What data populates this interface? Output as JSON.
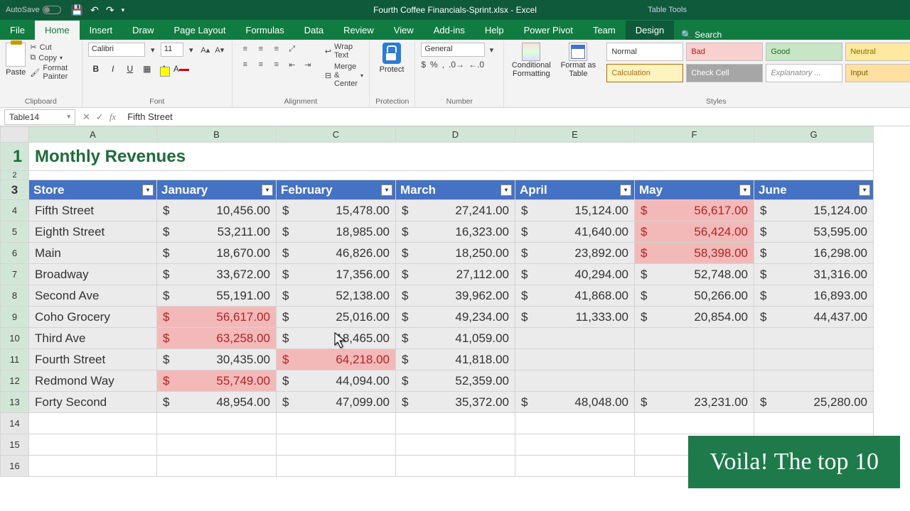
{
  "title_bar": {
    "autosave": "AutoSave",
    "doc_title": "Fourth Coffee Financials-Sprint.xlsx - Excel",
    "table_tools": "Table Tools"
  },
  "tabs": {
    "file": "File",
    "home": "Home",
    "insert": "Insert",
    "draw": "Draw",
    "page_layout": "Page Layout",
    "formulas": "Formulas",
    "data": "Data",
    "review": "Review",
    "view": "View",
    "help": "Help",
    "addins": "Add-ins",
    "power_pivot": "Power Pivot",
    "team": "Team",
    "design": "Design",
    "search": "Search"
  },
  "ribbon": {
    "clipboard": {
      "paste": "Paste",
      "cut": "Cut",
      "copy": "Copy",
      "format_painter": "Format Painter",
      "label": "Clipboard"
    },
    "font": {
      "name": "Calibri",
      "size": "11",
      "label": "Font"
    },
    "alignment": {
      "wrap": "Wrap Text",
      "merge": "Merge & Center",
      "label": "Alignment"
    },
    "protection": {
      "protect": "Protect",
      "label": "Protection"
    },
    "number": {
      "format": "General",
      "label": "Number"
    },
    "cf": "Conditional Formatting",
    "fat": "Format as Table",
    "styles": {
      "normal": "Normal",
      "bad": "Bad",
      "good": "Good",
      "neutral": "Neutral",
      "calculation": "Calculation",
      "check": "Check Cell",
      "explanatory": "Explanatory ...",
      "input": "Input",
      "label": "Styles"
    }
  },
  "fx": {
    "name_box": "Table14",
    "formula": "Fifth Street"
  },
  "sheet": {
    "title": "Monthly Revenues",
    "columns": [
      "A",
      "B",
      "C",
      "D",
      "E",
      "F",
      "G"
    ],
    "row_numbers": [
      1,
      2,
      3,
      4,
      5,
      6,
      7,
      8,
      9,
      10,
      11,
      12,
      13,
      14,
      15,
      16
    ],
    "headers": [
      "Store",
      "January",
      "February",
      "March",
      "April",
      "May",
      "June"
    ],
    "rows": [
      {
        "store": "Fifth Street",
        "vals": [
          "10,456.00",
          "15,478.00",
          "27,241.00",
          "15,124.00",
          "56,617.00",
          "15,124.00"
        ],
        "hl": [
          false,
          false,
          false,
          false,
          true,
          false
        ]
      },
      {
        "store": "Eighth Street",
        "vals": [
          "53,211.00",
          "18,985.00",
          "16,323.00",
          "41,640.00",
          "56,424.00",
          "53,595.00"
        ],
        "hl": [
          false,
          false,
          false,
          false,
          true,
          false
        ]
      },
      {
        "store": "Main",
        "vals": [
          "18,670.00",
          "46,826.00",
          "18,250.00",
          "23,892.00",
          "58,398.00",
          "16,298.00"
        ],
        "hl": [
          false,
          false,
          false,
          false,
          true,
          false
        ]
      },
      {
        "store": "Broadway",
        "vals": [
          "33,672.00",
          "17,356.00",
          "27,112.00",
          "40,294.00",
          "52,748.00",
          "31,316.00"
        ],
        "hl": [
          false,
          false,
          false,
          false,
          false,
          false
        ]
      },
      {
        "store": "Second Ave",
        "vals": [
          "55,191.00",
          "52,138.00",
          "39,962.00",
          "41,868.00",
          "50,266.00",
          "16,893.00"
        ],
        "hl": [
          false,
          false,
          false,
          false,
          false,
          false
        ]
      },
      {
        "store": "Coho Grocery",
        "vals": [
          "56,617.00",
          "25,016.00",
          "49,234.00",
          "11,333.00",
          "20,854.00",
          "44,437.00"
        ],
        "hl": [
          true,
          false,
          false,
          false,
          false,
          false
        ]
      },
      {
        "store": "Third Ave",
        "vals": [
          "63,258.00",
          "18,465.00",
          "41,059.00",
          "",
          "",
          ""
        ],
        "hl": [
          true,
          false,
          false,
          true,
          false,
          false
        ]
      },
      {
        "store": "Fourth Street",
        "vals": [
          "30,435.00",
          "64,218.00",
          "41,818.00",
          "",
          "",
          ""
        ],
        "hl": [
          false,
          true,
          false,
          false,
          false,
          false
        ]
      },
      {
        "store": "Redmond Way",
        "vals": [
          "55,749.00",
          "44,094.00",
          "52,359.00",
          "",
          "",
          ""
        ],
        "hl": [
          true,
          false,
          false,
          true,
          false,
          false
        ]
      },
      {
        "store": "Forty Second",
        "vals": [
          "48,954.00",
          "47,099.00",
          "35,372.00",
          "48,048.00",
          "23,231.00",
          "25,280.00"
        ],
        "hl": [
          false,
          false,
          false,
          false,
          false,
          false
        ]
      }
    ]
  },
  "callout": {
    "bold": "Voila!",
    "rest": " The top 10"
  },
  "chart_data": {
    "type": "table",
    "title": "Monthly Revenues",
    "columns": [
      "Store",
      "January",
      "February",
      "March",
      "April",
      "May",
      "June"
    ],
    "rows": [
      [
        "Fifth Street",
        10456.0,
        15478.0,
        27241.0,
        15124.0,
        56617.0,
        15124.0
      ],
      [
        "Eighth Street",
        53211.0,
        18985.0,
        16323.0,
        41640.0,
        56424.0,
        53595.0
      ],
      [
        "Main",
        18670.0,
        46826.0,
        18250.0,
        23892.0,
        58398.0,
        16298.0
      ],
      [
        "Broadway",
        33672.0,
        17356.0,
        27112.0,
        40294.0,
        52748.0,
        31316.0
      ],
      [
        "Second Ave",
        55191.0,
        52138.0,
        39962.0,
        41868.0,
        50266.0,
        16893.0
      ],
      [
        "Coho Grocery",
        56617.0,
        25016.0,
        49234.0,
        11333.0,
        20854.0,
        44437.0
      ],
      [
        "Third Ave",
        63258.0,
        18465.0,
        41059.0,
        null,
        null,
        null
      ],
      [
        "Fourth Street",
        30435.0,
        64218.0,
        41818.0,
        null,
        null,
        null
      ],
      [
        "Redmond Way",
        55749.0,
        44094.0,
        52359.0,
        null,
        null,
        null
      ],
      [
        "Forty Second",
        48954.0,
        47099.0,
        35372.0,
        48048.0,
        23231.0,
        25280.0
      ]
    ],
    "highlight_rule": "top 10 values across all numeric cells highlighted light red"
  }
}
